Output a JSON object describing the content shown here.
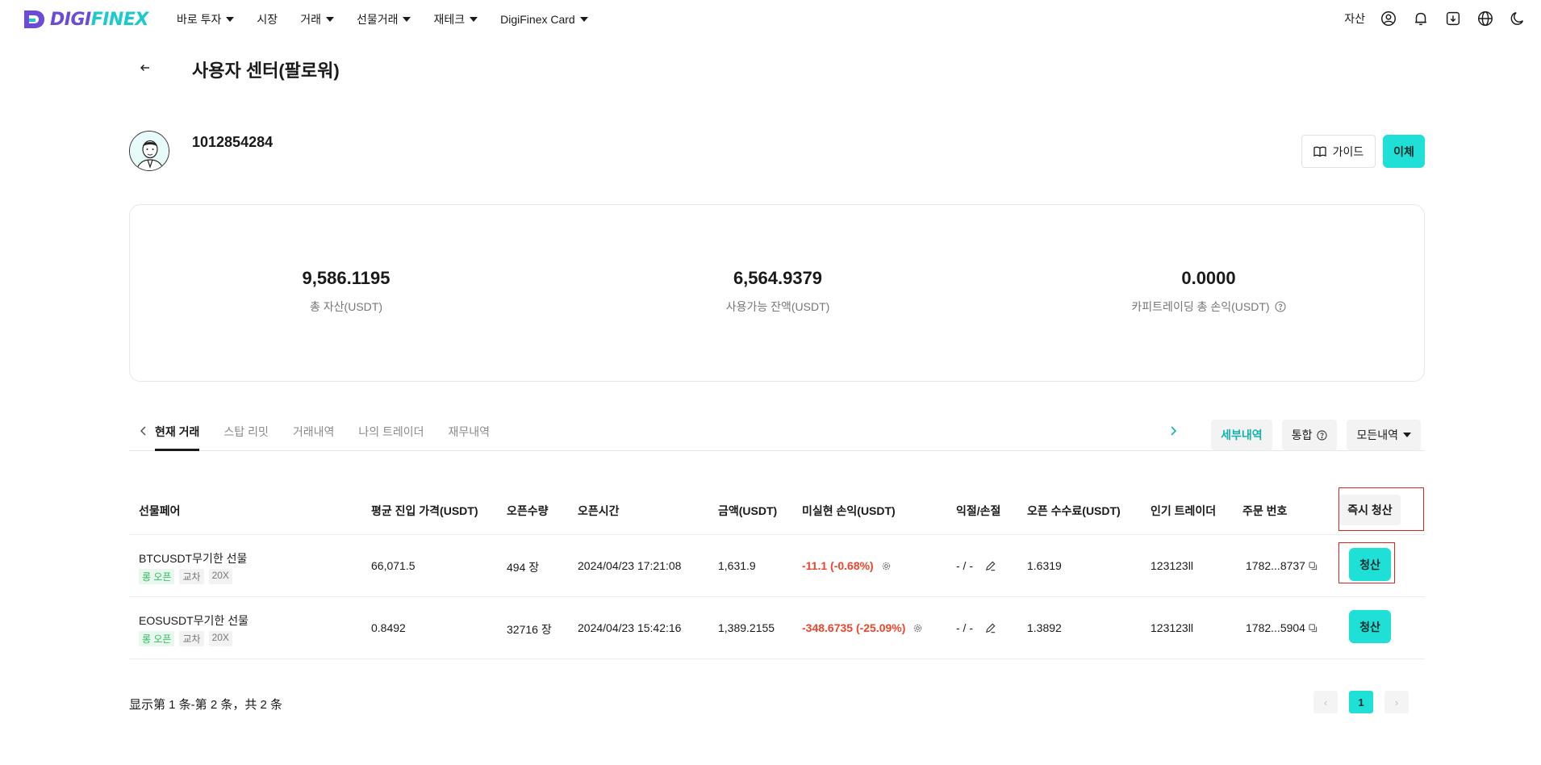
{
  "brand": {
    "logo_text_a": "DIGI",
    "logo_text_b": "FINEX",
    "accent": "#1ee0d6",
    "logo_color": "#6b4bd8"
  },
  "nav": {
    "items": [
      {
        "label": "바로 투자",
        "dropdown": true
      },
      {
        "label": "시장",
        "dropdown": false
      },
      {
        "label": "거래",
        "dropdown": true
      },
      {
        "label": "선물거래",
        "dropdown": true
      },
      {
        "label": "재테크",
        "dropdown": true
      },
      {
        "label": "DigiFinex Card",
        "dropdown": true
      }
    ],
    "asset_label": "자산",
    "icons": [
      "user-icon",
      "bell-icon",
      "download-icon",
      "globe-icon",
      "moon-icon"
    ]
  },
  "page": {
    "title": "사용자 센터(팔로워)"
  },
  "profile": {
    "user_id": "1012854284",
    "guide_label": "가이드",
    "transfer_label": "이체"
  },
  "stats": {
    "total_asset_value": "9,586.1195",
    "total_asset_label": "총 자산(USDT)",
    "available_value": "6,564.9379",
    "available_label": "사용가능 잔액(USDT)",
    "copy_pnl_value": "0.0000",
    "copy_pnl_label": "카피트레이딩 총 손익(USDT)"
  },
  "tabs": {
    "items": [
      "현재 거래",
      "스탑 리밋",
      "거래내역",
      "나의 트레이더",
      "재무내역"
    ],
    "active_index": 0,
    "detail_label": "세부내역",
    "merge_label": "통합",
    "all_label": "모든내역"
  },
  "table": {
    "headers": {
      "pair": "선물페어",
      "avg_entry": "평균 진입 가격(USDT)",
      "qty": "오픈수량",
      "open_time": "오픈시간",
      "amount": "금액(USDT)",
      "unrealized_pnl": "미실현 손익(USDT)",
      "tpsl": "익절/손절",
      "open_fee": "오픈 수수료(USDT)",
      "trader": "인기 트레이더",
      "order_no": "주문 번호",
      "instant_close": "즉시 청산"
    },
    "rows": [
      {
        "pair": "BTCUSDT무기한 선물",
        "tag_side": "롱 오픈",
        "tag_margin": "교차",
        "tag_leverage": "20X",
        "avg_entry": "66,071.5",
        "qty": "494 장",
        "open_time": "2024/04/23 17:21:08",
        "amount": "1,631.9",
        "pnl": "-11.1 (-0.68%)",
        "tpsl": "- / -",
        "open_fee": "1.6319",
        "trader": "123123ll",
        "order_no": "1782...8737",
        "close_label": "청산"
      },
      {
        "pair": "EOSUSDT무기한 선물",
        "tag_side": "롱 오픈",
        "tag_margin": "교차",
        "tag_leverage": "20X",
        "avg_entry": "0.8492",
        "qty": "32716 장",
        "open_time": "2024/04/23 15:42:16",
        "amount": "1,389.2155",
        "pnl": "-348.6735 (-25.09%)",
        "tpsl": "- / -",
        "open_fee": "1.3892",
        "trader": "123123ll",
        "order_no": "1782...5904",
        "close_label": "청산"
      }
    ]
  },
  "footer": {
    "showing_text": "显示第 1 条-第 2 条，共 2 条",
    "current_page": "1",
    "prev_arrow": "‹",
    "next_arrow": "›"
  }
}
